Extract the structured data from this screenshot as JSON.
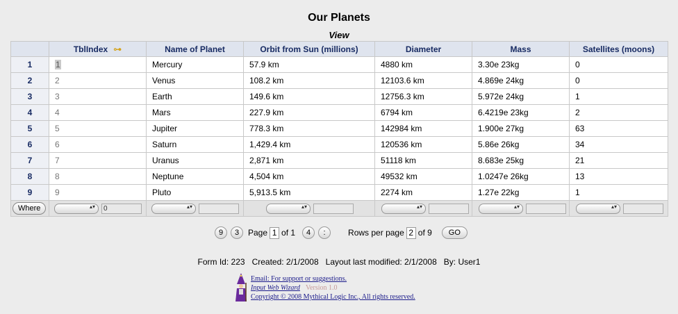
{
  "page": {
    "title": "Our Planets",
    "subtitle": "View"
  },
  "table": {
    "headers": [
      "",
      "TblIndex",
      "Name of Planet",
      "Orbit from Sun (millions)",
      "Diameter",
      "Mass",
      "Satellites (moons)"
    ],
    "key_icon": "key-icon",
    "rows": [
      [
        "1",
        "1",
        "Mercury",
        "57.9 km",
        "4880 km",
        "3.30e 23kg",
        "0"
      ],
      [
        "2",
        "2",
        "Venus",
        "108.2 km",
        "12103.6 km",
        "4.869e 24kg",
        "0"
      ],
      [
        "3",
        "3",
        "Earth",
        "149.6 km",
        "12756.3 km",
        "5.972e 24kg",
        "1"
      ],
      [
        "4",
        "4",
        "Mars",
        "227.9 km",
        "6794 km",
        "6.4219e 23kg",
        "2"
      ],
      [
        "5",
        "5",
        "Jupiter",
        "778.3 km",
        "142984 km",
        "1.900e 27kg",
        "63"
      ],
      [
        "6",
        "6",
        "Saturn",
        "1,429.4 km",
        "120536 km",
        "5.86e 26kg",
        "34"
      ],
      [
        "7",
        "7",
        "Uranus",
        "2,871 km",
        "51118 km",
        "8.683e 25kg",
        "21"
      ],
      [
        "8",
        "8",
        "Neptune",
        "4,504 km",
        "49532 km",
        "1.0247e 26kg",
        "13"
      ],
      [
        "9",
        "9",
        "Pluto",
        "5,913.5 km",
        "2274 km",
        "1.27e 22kg",
        "1"
      ]
    ],
    "filter": {
      "where_label": "Where",
      "first_value": "0"
    }
  },
  "pager": {
    "first_btn": "9",
    "prev_btn": "3",
    "page_label": "Page",
    "page_value": "1",
    "of_pages": "of 1",
    "next_btn": "4",
    "last_btn": ":",
    "rows_label": "Rows per page",
    "rows_value": "2",
    "of_rows": "of 9",
    "go_label": "GO"
  },
  "info": {
    "form_id": "Form Id: 223",
    "created": "Created: 2/1/2008",
    "modified": "Layout last modified: 2/1/2008",
    "by": "By: User1"
  },
  "footer": {
    "email": "Email: For support or suggestions.",
    "wizard": "Input Web Wizard",
    "version": "Version 1.0",
    "copyright": "Copyright © 2008 Mythical Logic Inc., All rights reserved."
  }
}
